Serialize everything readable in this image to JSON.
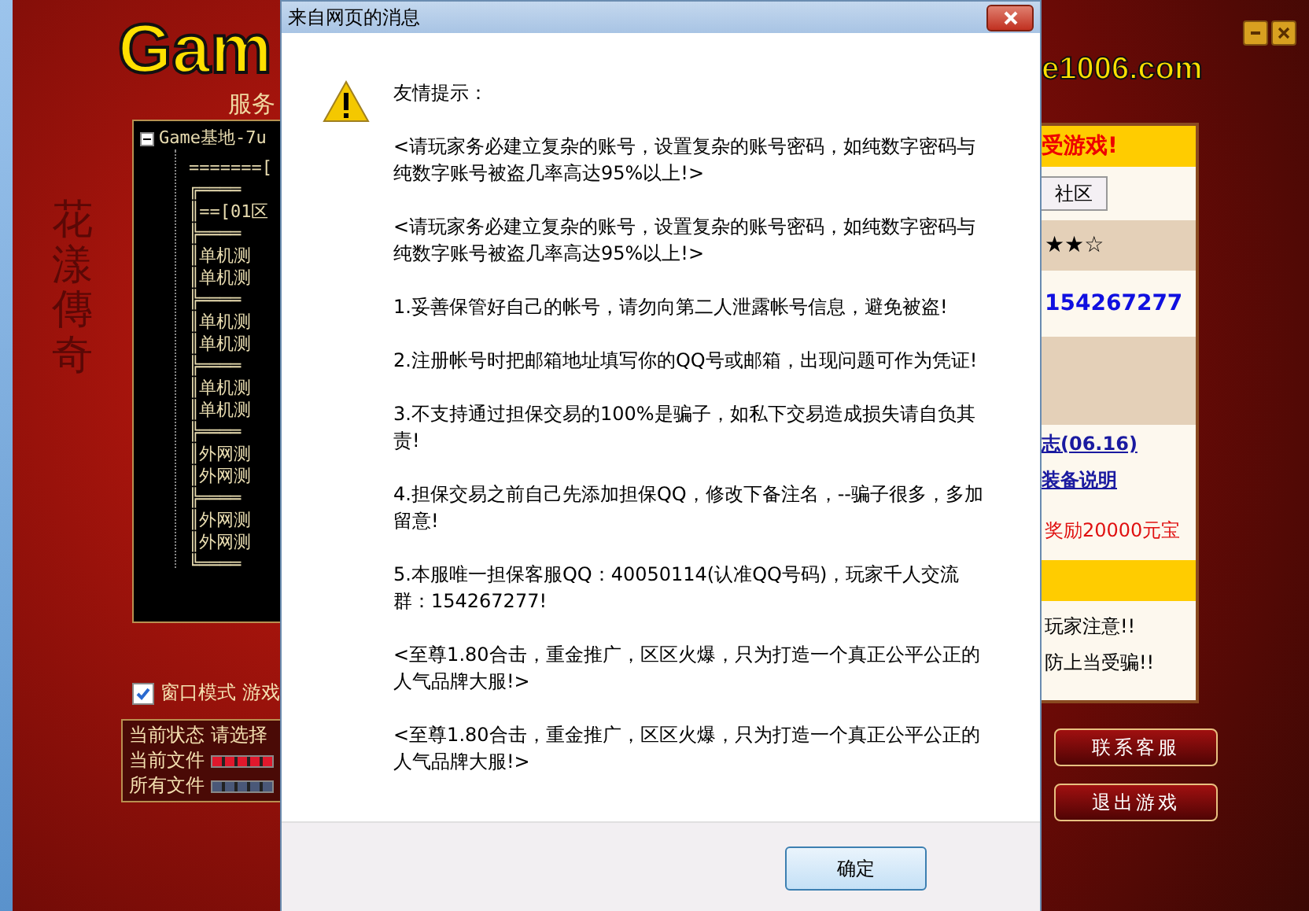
{
  "launcher": {
    "logo_left": "Gam",
    "logo_right": "e1006.com",
    "server_heading": "服务",
    "art_title": "花漾傳奇",
    "tree": {
      "label": "Game基地-7u",
      "expanded": true,
      "children": [
        "=======[",
        "╔════",
        "║==[01区",
        "╠════",
        "║单机测",
        "║单机测",
        "╠════",
        "║单机测",
        "║单机测",
        "╠════",
        "║单机测",
        "║单机测",
        "╠════",
        "║外网测",
        "║外网测",
        "╠════",
        "║外网测",
        "║外网测",
        "╚════"
      ]
    },
    "window_mode": {
      "label": "窗口模式",
      "checked": true,
      "extra": "游戏"
    },
    "status": [
      {
        "kind": "text",
        "label": "当前状态",
        "value": "请选择"
      },
      {
        "kind": "bar",
        "label": "当前文件",
        "color": "#e0182c"
      },
      {
        "kind": "bar",
        "label": "所有文件",
        "color": "#4a5878"
      }
    ],
    "side_panel": [
      {
        "kind": "banner",
        "text": "受游戏!"
      },
      {
        "kind": "button",
        "text": "社区"
      },
      {
        "kind": "rating",
        "text": "★★☆"
      },
      {
        "kind": "number",
        "text": "154267277"
      },
      {
        "kind": "blank"
      },
      {
        "kind": "links",
        "items": [
          "志(06.16)",
          "装备说明"
        ]
      },
      {
        "kind": "notice",
        "text": "奖励20000元宝"
      },
      {
        "kind": "banner"
      },
      {
        "kind": "notes",
        "items": [
          "玩家注意!!",
          "防上当受骗!!"
        ]
      }
    ],
    "buttons": [
      "联系客服",
      "退出游戏"
    ]
  },
  "dialog": {
    "title": "来自网页的消息",
    "heading": "友情提示：",
    "paragraphs": [
      "<请玩家务必建立复杂的账号，设置复杂的账号密码，如纯数字密码与纯数字账号被盗几率高达95%以上!>",
      "<请玩家务必建立复杂的账号，设置复杂的账号密码，如纯数字密码与纯数字账号被盗几率高达95%以上!>",
      "1.妥善保管好自己的帐号，请勿向第二人泄露帐号信息，避免被盗!",
      "2.注册帐号时把邮箱地址填写你的QQ号或邮箱，出现问题可作为凭证!",
      "3.不支持通过担保交易的100%是骗子，如私下交易造成损失请自负其责!",
      "4.担保交易之前自己先添加担保QQ，修改下备注名，--骗子很多，多加留意!",
      "5.本服唯一担保客服QQ：40050114(认准QQ号码)，玩家千人交流群：154267277!",
      "<至尊1.80合击，重金推广，区区火爆，只为打造一个真正公平公正的人气品牌大服!>",
      "<至尊1.80合击，重金推广，区区火爆，只为打造一个真正公平公正的人气品牌大服!>"
    ],
    "buttons": [
      "确定"
    ]
  }
}
